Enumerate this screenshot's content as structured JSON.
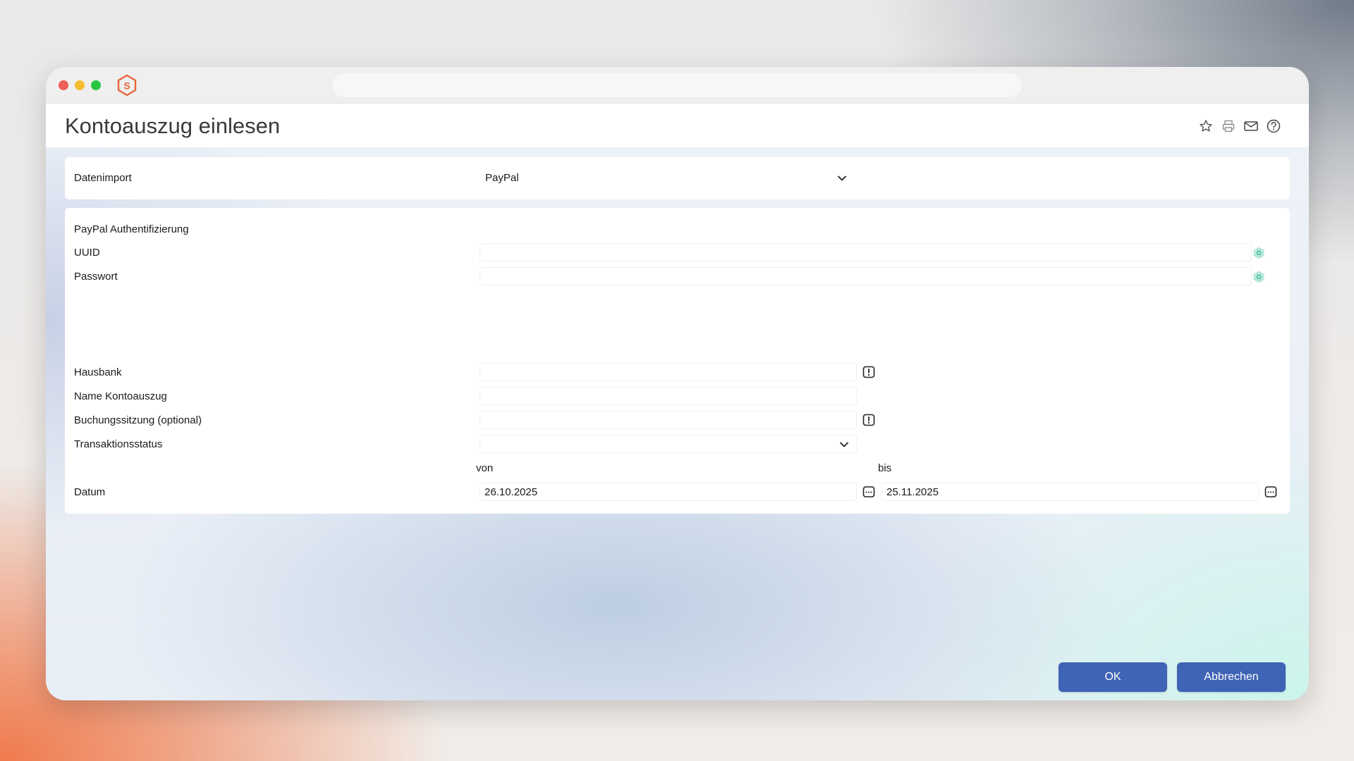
{
  "window": {
    "title": "Kontoauszug einlesen"
  },
  "header_icons": [
    "star-icon",
    "printer-icon",
    "mail-icon",
    "help-icon"
  ],
  "datenimport": {
    "label": "Datenimport",
    "selected": "PayPal"
  },
  "auth": {
    "section_label": "PayPal Authentifizierung",
    "uuid_label": "UUID",
    "uuid_value": "",
    "password_label": "Passwort",
    "password_value": ""
  },
  "form": {
    "hausbank_label": "Hausbank",
    "hausbank_value": "",
    "name_label": "Name Kontoauszug",
    "name_value": "",
    "buchung_label": "Buchungssitzung (optional)",
    "buchung_value": "",
    "status_label": "Transaktionsstatus",
    "status_selected": "",
    "von_label": "von",
    "bis_label": "bis",
    "datum_label": "Datum",
    "date_from": "26.10.2025",
    "date_to": "25.11.2025"
  },
  "buttons": {
    "ok": "OK",
    "cancel": "Abbrechen"
  },
  "colors": {
    "primary_button": "#3f63b5",
    "traffic_red": "#ee5f57",
    "traffic_yellow": "#f5bd2f",
    "traffic_green": "#29c740",
    "logo_orange": "#e8643a",
    "key_icon_green": "#4fc3a1"
  }
}
